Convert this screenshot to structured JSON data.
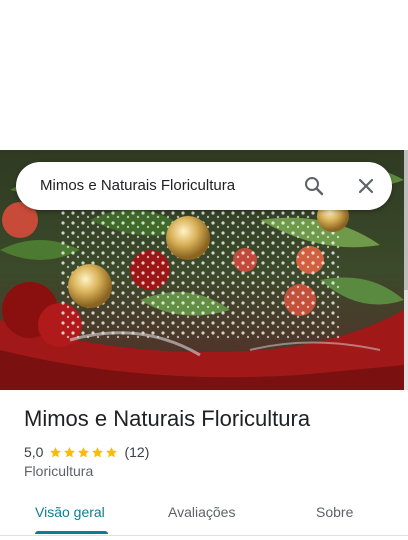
{
  "search": {
    "query": "Mimos e Naturais Floricultura",
    "search_icon": "search-icon",
    "close_icon": "close-icon"
  },
  "hero": {
    "image": "flower-bouquet-photo"
  },
  "place": {
    "name": "Mimos e Naturais Floricultura",
    "rating": "5,0",
    "rating_stars": 5,
    "review_count": "(12)",
    "category": "Floricultura"
  },
  "tabs": [
    {
      "label": "Visão geral",
      "active": true
    },
    {
      "label": "Avaliações",
      "active": false
    },
    {
      "label": "Sobre",
      "active": false
    }
  ],
  "colors": {
    "accent": "#0b7f8f",
    "star": "#fbbc04",
    "text_primary": "#202124",
    "text_secondary": "#5f6368"
  }
}
